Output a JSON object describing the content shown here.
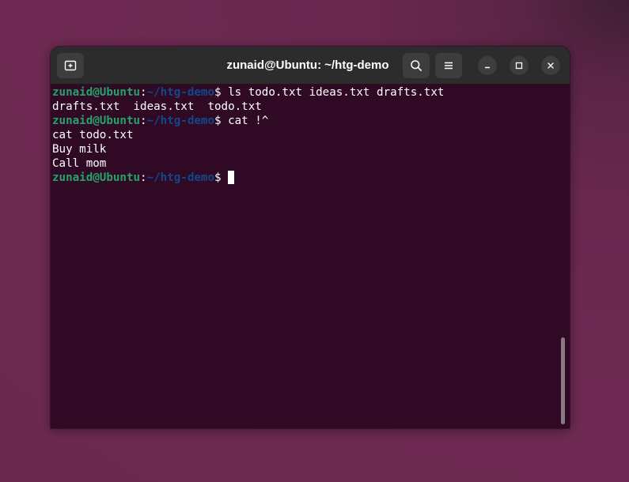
{
  "window": {
    "title": "zunaid@Ubuntu: ~/htg-demo"
  },
  "icons": {
    "new_tab": "new-tab-icon",
    "search": "search-icon",
    "menu": "hamburger-menu-icon",
    "minimize": "minimize-icon",
    "maximize": "maximize-icon",
    "close": "close-icon"
  },
  "colors": {
    "terminal_bg": "#300a24",
    "prompt_user": "#26a269",
    "prompt_path": "#12488b",
    "text": "#ffffff",
    "titlebar": "#2c2c2c"
  },
  "terminal": {
    "prompt": {
      "user": "zunaid@Ubuntu",
      "colon": ":",
      "path": "~/htg-demo",
      "symbol": "$"
    },
    "lines": [
      {
        "kind": "command",
        "text": " ls todo.txt ideas.txt drafts.txt"
      },
      {
        "kind": "output",
        "text": "drafts.txt  ideas.txt  todo.txt"
      },
      {
        "kind": "command",
        "text": " cat !^"
      },
      {
        "kind": "output",
        "text": "cat todo.txt"
      },
      {
        "kind": "output",
        "text": "Buy milk"
      },
      {
        "kind": "output",
        "text": "Call mom"
      },
      {
        "kind": "command",
        "text": " "
      }
    ]
  }
}
